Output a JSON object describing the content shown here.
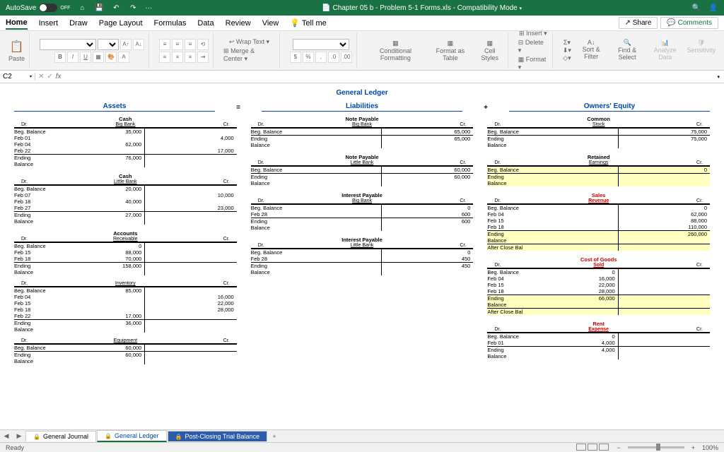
{
  "titlebar": {
    "autosave_label": "AutoSave",
    "autosave_state": "OFF",
    "filename": "Chapter 05 b - Problem 5-1 Forms.xls - Compatibility Mode"
  },
  "tabs": [
    "Home",
    "Insert",
    "Draw",
    "Page Layout",
    "Formulas",
    "Data",
    "Review",
    "View",
    "Tell me"
  ],
  "active_tab": "Home",
  "share": "Share",
  "comments": "Comments",
  "ribbon": {
    "paste": "Paste",
    "wrap": "Wrap Text",
    "merge": "Merge & Center",
    "cond": "Conditional Formatting",
    "fmt_table": "Format as Table",
    "cell_styles": "Cell Styles",
    "insert": "Insert",
    "delete": "Delete",
    "format": "Format",
    "sort": "Sort & Filter",
    "find": "Find & Select",
    "analyze": "Analyze Data",
    "sens": "Sensitivity"
  },
  "cellref": "C2",
  "ledger": {
    "title": "General Ledger",
    "assets": "Assets",
    "liab": "Liabilities",
    "equity": "Owners' Equity",
    "cash_big": {
      "name": "Cash",
      "bank": "Big Bank",
      "rows": [
        [
          "Beg. Balance",
          "35,000",
          ""
        ],
        [
          "Feb 01",
          "",
          "4,000"
        ],
        [
          "Feb 04",
          "62,000",
          ""
        ],
        [
          "Feb 22",
          "",
          "17,000"
        ],
        [
          "Ending Balance",
          "76,000",
          ""
        ]
      ]
    },
    "cash_little": {
      "name": "Cash",
      "bank": "Little Bank",
      "rows": [
        [
          "Beg. Balance",
          "20,000",
          ""
        ],
        [
          "Feb 07",
          "",
          "10,000"
        ],
        [
          "Feb 18",
          "40,000",
          ""
        ],
        [
          "Feb 27",
          "",
          "23,000"
        ],
        [
          "Ending Balance",
          "27,000",
          ""
        ]
      ]
    },
    "ar": {
      "name": "Accounts",
      "sub": "Receivable",
      "rows": [
        [
          "Beg. Balance",
          "0",
          ""
        ],
        [
          "Feb 15",
          "88,000",
          ""
        ],
        [
          "Feb 18",
          "70,000",
          ""
        ],
        [
          "Ending Balance",
          "158,000",
          ""
        ]
      ]
    },
    "inv": {
      "name": "",
      "sub": "Inventory",
      "rows": [
        [
          "Beg. Balance",
          "85,000",
          ""
        ],
        [
          "Feb 04",
          "",
          "16,000"
        ],
        [
          "Feb 15",
          "",
          "22,000"
        ],
        [
          "Feb 18",
          "",
          "28,000"
        ],
        [
          "Feb 22",
          "17,000",
          ""
        ],
        [
          "Ending Balance",
          "36,000",
          ""
        ]
      ]
    },
    "equip": {
      "sub": "Equipment",
      "rows": [
        [
          "Beg. Balance",
          "60,000",
          ""
        ],
        [
          "",
          "",
          ""
        ],
        [
          "Ending Balance",
          "60,000",
          ""
        ]
      ]
    },
    "np_big": {
      "name": "Note Payable",
      "bank": "Big Bank",
      "rows": [
        [
          "Beg. Balance",
          "",
          "65,000"
        ],
        [
          "",
          "",
          ""
        ],
        [
          "Ending Balance",
          "",
          "65,000"
        ]
      ]
    },
    "np_little": {
      "name": "Note Payable",
      "bank": "Little Bank",
      "rows": [
        [
          "Beg. Balance",
          "",
          "60,000"
        ],
        [
          "",
          "",
          ""
        ],
        [
          "Ending Balance",
          "",
          "60,000"
        ]
      ]
    },
    "int_big": {
      "name": "Interest Payable",
      "bank": "Big Bank",
      "rows": [
        [
          "Beg. Balance",
          "",
          "0"
        ],
        [
          "Feb 28",
          "",
          "600"
        ],
        [
          "Ending Balance",
          "",
          "600"
        ]
      ]
    },
    "int_little": {
      "name": "Interest Payable",
      "bank": "Little Bank",
      "rows": [
        [
          "Beg. Balance",
          "",
          "0"
        ],
        [
          "Feb 28",
          "",
          "450"
        ],
        [
          "Ending Balance",
          "",
          "450"
        ]
      ]
    },
    "stock": {
      "name": "Common",
      "sub": "Stock",
      "rows": [
        [
          "Beg. Balance",
          "",
          "75,000"
        ],
        [
          "",
          "",
          ""
        ],
        [
          "Ending Balance",
          "",
          "75,000"
        ]
      ]
    },
    "re": {
      "name": "Retained",
      "sub": "Earnings",
      "rows": [
        [
          "Beg. Balance",
          "",
          "0"
        ],
        [
          "",
          "",
          ""
        ],
        [
          "Ending Balance",
          "",
          ""
        ]
      ]
    },
    "sales": {
      "name": "Sales",
      "sub": "Revenue",
      "rows": [
        [
          "Beg. Balance",
          "",
          "0"
        ],
        [
          "Feb 04",
          "",
          "62,000"
        ],
        [
          "Feb 15",
          "",
          "88,000"
        ],
        [
          "Feb 18",
          "",
          "110,000"
        ],
        [
          "Ending Balance",
          "",
          "260,000"
        ],
        [
          "After Close Bal",
          "",
          ""
        ]
      ]
    },
    "cogs": {
      "name": "Cost of Goods",
      "sub": "Sold",
      "rows": [
        [
          "Beg. Balance",
          "0",
          ""
        ],
        [
          "Feb 04",
          "16,000",
          ""
        ],
        [
          "Feb 15",
          "22,000",
          ""
        ],
        [
          "Feb 18",
          "28,000",
          ""
        ],
        [
          "Ending Balance",
          "66,000",
          ""
        ],
        [
          "After Close Bal",
          "",
          ""
        ]
      ]
    },
    "rent": {
      "name": "Rent",
      "sub": "Expense",
      "rows": [
        [
          "Beg. Balance",
          "0",
          ""
        ],
        [
          "Feb 01",
          "4,000",
          ""
        ],
        [
          "Ending Balance",
          "4,000",
          ""
        ]
      ]
    }
  },
  "sheets": {
    "gj": "General Journal",
    "gl": "General Ledger",
    "pc": "Post-Closing Trial Balance"
  },
  "status": {
    "ready": "Ready",
    "zoom": "100%"
  }
}
